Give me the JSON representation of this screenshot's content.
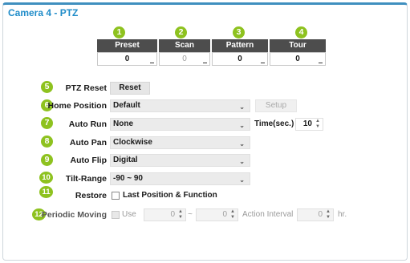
{
  "window": {
    "title": "Camera 4 - PTZ"
  },
  "badges": [
    "1",
    "2",
    "3",
    "4",
    "5",
    "6",
    "7",
    "8",
    "9",
    "10",
    "11",
    "12"
  ],
  "ptz_table": {
    "columns": [
      {
        "header": "Preset",
        "value": "0",
        "enabled": true
      },
      {
        "header": "Scan",
        "value": "0",
        "enabled": false
      },
      {
        "header": "Pattern",
        "value": "0",
        "enabled": true
      },
      {
        "header": "Tour",
        "value": "0",
        "enabled": true
      }
    ]
  },
  "ptz_reset": {
    "label": "PTZ Reset",
    "button": "Reset"
  },
  "home_position": {
    "label": "Home Position",
    "value": "Default",
    "setup_button": "Setup"
  },
  "auto_run": {
    "label": "Auto Run",
    "value": "None",
    "time_label": "Time(sec.)",
    "time_value": "10"
  },
  "auto_pan": {
    "label": "Auto Pan",
    "value": "Clockwise"
  },
  "auto_flip": {
    "label": "Auto Flip",
    "value": "Digital"
  },
  "tilt_range": {
    "label": "Tilt-Range",
    "value": "-90 ~ 90"
  },
  "restore": {
    "label": "Restore",
    "option": "Last Position & Function",
    "checked": false
  },
  "periodic_moving": {
    "label": "Periodic Moving",
    "use_label": "Use",
    "start_value": "0",
    "separator": "~",
    "end_value": "0",
    "interval_label": "Action Interval",
    "interval_value": "0",
    "interval_unit": "hr."
  },
  "colors": {
    "accent": "#1f8cc9",
    "badge": "#8ec21f",
    "table_header": "#4d4d4d"
  },
  "icons": {
    "dropdown": "chevron-down-icon",
    "spinner": "spinner-arrows-icon"
  }
}
